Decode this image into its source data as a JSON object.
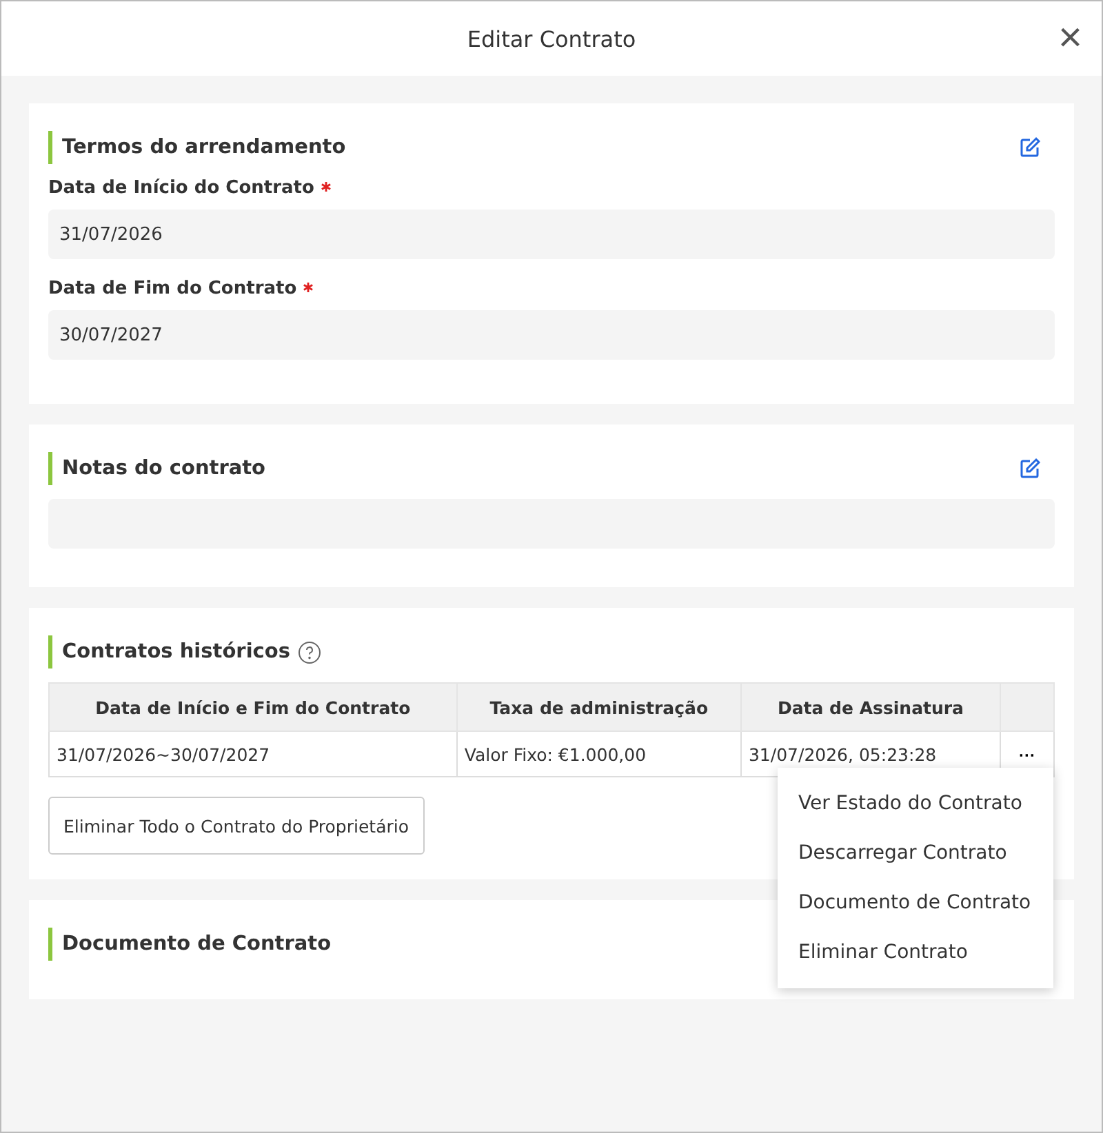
{
  "dialog": {
    "title": "Editar Contrato",
    "close": "×"
  },
  "lease_terms": {
    "title": "Termos do arrendamento",
    "fields": [
      {
        "label": "Data de Início do Contrato",
        "required": true,
        "value": "31/07/2026"
      },
      {
        "label": "Data de Fim do Contrato",
        "required": true,
        "value": "30/07/2027"
      }
    ]
  },
  "notes": {
    "title": "Notas do contrato"
  },
  "history": {
    "title": "Contratos históricos",
    "columns": [
      "Data de Início e Fim do Contrato",
      "Taxa de administração",
      "Data de Assinatura"
    ],
    "rows": [
      {
        "cells": [
          "31/07/2026~30/07/2027",
          "Valor Fixo: €1.000,00",
          "31/07/2026, 05:23:28"
        ],
        "more": "···"
      }
    ],
    "delete_all_button": "Eliminar Todo o Contrato do Proprietário"
  },
  "document": {
    "title": "Documento de Contrato"
  },
  "row_menu": {
    "items": [
      "Ver Estado do Contrato",
      "Descarregar Contrato",
      "Documento de Contrato",
      "Eliminar Contrato"
    ]
  }
}
